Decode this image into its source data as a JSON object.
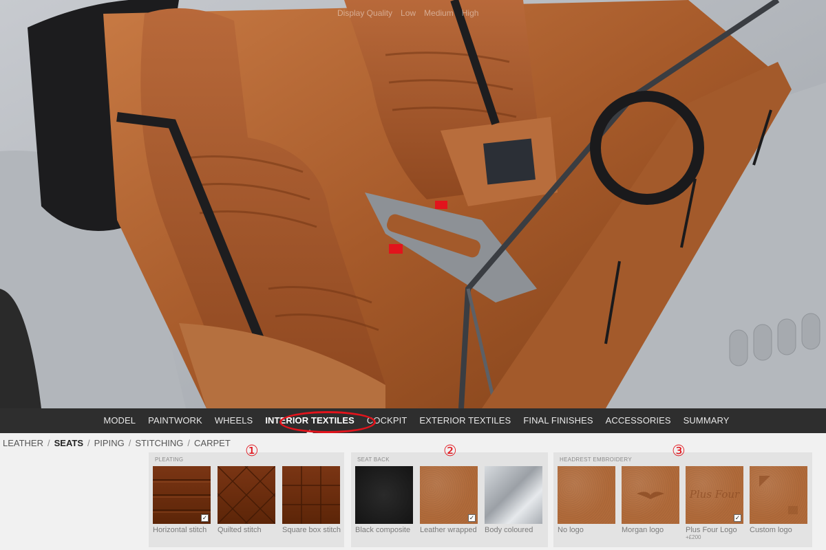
{
  "display_quality": {
    "label": "Display Quality",
    "options": [
      "Low",
      "Medium",
      "High"
    ]
  },
  "nav": {
    "items": [
      {
        "label": "MODEL",
        "active": false
      },
      {
        "label": "PAINTWORK",
        "active": false
      },
      {
        "label": "WHEELS",
        "active": false
      },
      {
        "label": "INTERIOR TEXTILES",
        "active": true
      },
      {
        "label": "COCKPIT",
        "active": false
      },
      {
        "label": "EXTERIOR TEXTILES",
        "active": false
      },
      {
        "label": "FINAL FINISHES",
        "active": false
      },
      {
        "label": "ACCESSORIES",
        "active": false
      },
      {
        "label": "SUMMARY",
        "active": false
      }
    ]
  },
  "subnav": {
    "items": [
      {
        "label": "LEATHER",
        "active": false
      },
      {
        "label": "SEATS",
        "active": true
      },
      {
        "label": "PIPING",
        "active": false
      },
      {
        "label": "STITCHING",
        "active": false
      },
      {
        "label": "CARPET",
        "active": false
      }
    ]
  },
  "panels": [
    {
      "marker": "①",
      "title": "PLEATING",
      "options": [
        {
          "caption": "Horizontal stitch",
          "selected": true
        },
        {
          "caption": "Quilted stitch",
          "selected": false
        },
        {
          "caption": "Square box stitch",
          "selected": false
        }
      ]
    },
    {
      "marker": "②",
      "title": "SEAT BACK",
      "options": [
        {
          "caption": "Black composite",
          "selected": false
        },
        {
          "caption": "Leather wrapped",
          "selected": true
        },
        {
          "caption": "Body coloured",
          "selected": false
        }
      ]
    },
    {
      "marker": "③",
      "title": "HEADREST EMBROIDERY",
      "options": [
        {
          "caption": "No logo",
          "selected": false
        },
        {
          "caption": "Morgan logo",
          "selected": false
        },
        {
          "caption": "Plus Four Logo",
          "price": "+£200",
          "selected": true
        },
        {
          "caption": "Custom logo",
          "selected": false
        }
      ]
    }
  ],
  "headrest_embroidery_text": "Plus Four",
  "colors": {
    "leather": "#b06a3a",
    "accent_red": "#e2141c",
    "nav_bg": "#2e2e2e",
    "body_paint": "#b9bdc2"
  }
}
